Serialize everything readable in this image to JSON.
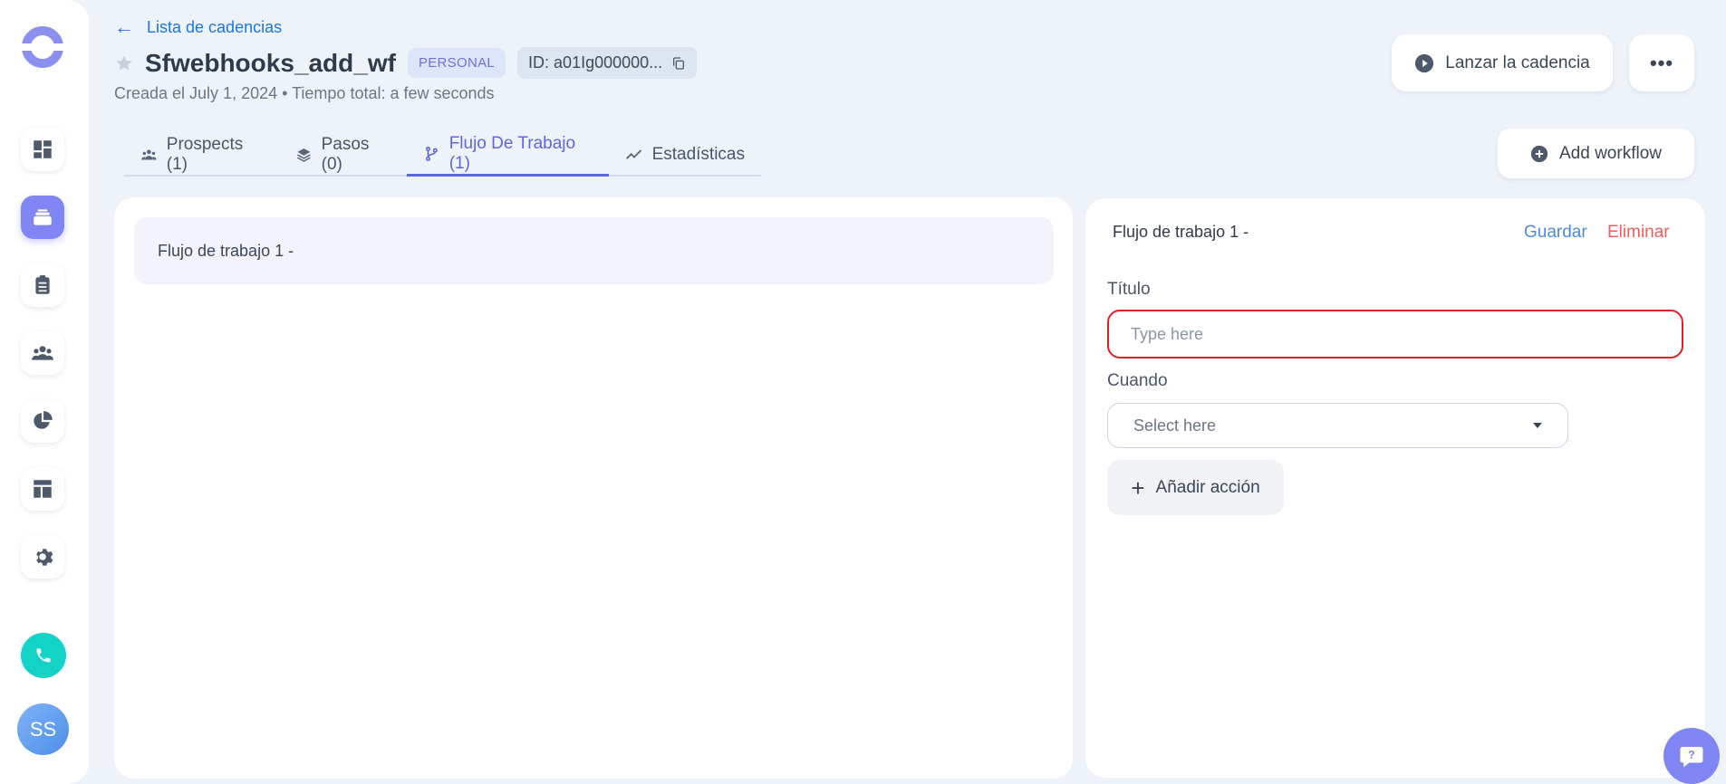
{
  "header": {
    "back_label": "Lista de cadencias",
    "title": "Sfwebhooks_add_wf",
    "badge": "PERSONAL",
    "id_label": "ID: a01Ig000000...",
    "subtitle": "Creada el July 1, 2024 • Tiempo total: a few seconds",
    "launch_label": "Lanzar la cadencia",
    "more_label": "•••"
  },
  "tabs": [
    {
      "label": "Prospects (1)",
      "icon": "users-icon"
    },
    {
      "label": "Pasos (0)",
      "icon": "layers-icon"
    },
    {
      "label": "Flujo De Trabajo (1)",
      "icon": "branch-icon",
      "active": true
    },
    {
      "label": "Estadísticas",
      "icon": "trend-icon"
    }
  ],
  "add_workflow_label": "Add workflow",
  "workflows": [
    {
      "label": "Flujo de trabajo 1 -"
    }
  ],
  "editor": {
    "title": "Flujo de trabajo 1 -",
    "save_label": "Guardar",
    "delete_label": "Eliminar",
    "title_label": "Título",
    "title_placeholder": "Type here",
    "when_label": "Cuando",
    "when_placeholder": "Select here",
    "add_action_label": "Añadir acción"
  },
  "sidebar": {
    "items": [
      {
        "name": "dashboard-icon"
      },
      {
        "name": "cadences-icon",
        "active": true
      },
      {
        "name": "tasks-icon"
      },
      {
        "name": "team-icon"
      },
      {
        "name": "reports-icon"
      },
      {
        "name": "templates-icon"
      },
      {
        "name": "settings-icon"
      }
    ],
    "avatar_initials": "SS"
  },
  "colors": {
    "accent": "#5f66de",
    "error": "#e01f2a",
    "link": "#1e74e0",
    "phone": "#13d3c6"
  }
}
